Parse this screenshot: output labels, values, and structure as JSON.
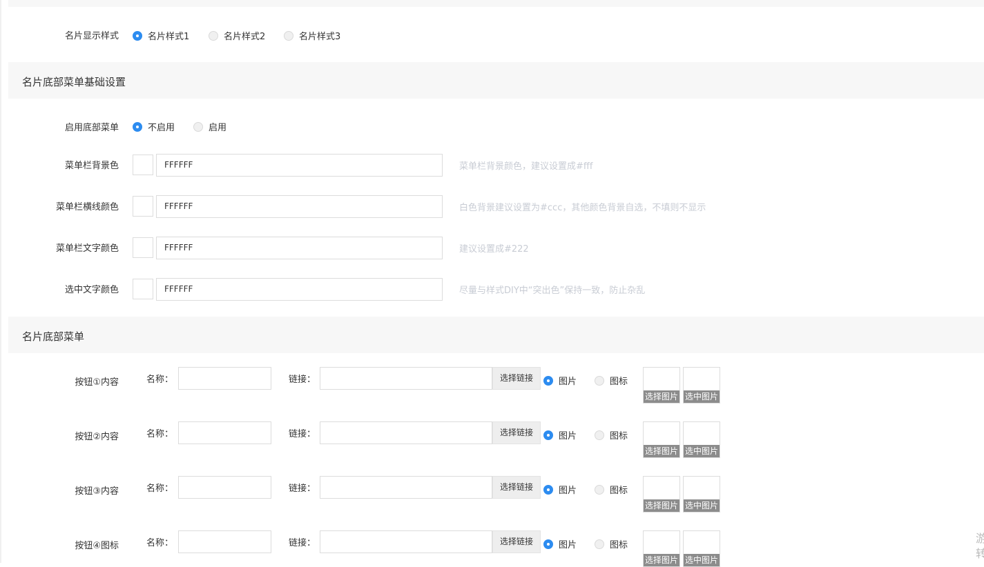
{
  "display_style": {
    "label": "名片显示样式",
    "options": [
      "名片样式1",
      "名片样式2",
      "名片样式3"
    ],
    "selected": 0
  },
  "menu_basic": {
    "title": "名片底部菜单基础设置",
    "enable_label": "启用底部菜单",
    "enable_options": [
      "不启用",
      "启用"
    ],
    "enable_selected": 0,
    "colors": [
      {
        "label": "菜单栏背景色",
        "value": "FFFFFF",
        "hint": "菜单栏背景颜色，建议设置成#fff"
      },
      {
        "label": "菜单栏横线颜色",
        "value": "FFFFFF",
        "hint": "白色背景建议设置为#ccc，其他颜色背景自选，不填则不显示"
      },
      {
        "label": "菜单栏文字颜色",
        "value": "FFFFFF",
        "hint": "建议设置成#222"
      },
      {
        "label": "选中文字颜色",
        "value": "FFFFFF",
        "hint": "尽量与样式DIY中“突出色”保持一致，防止杂乱"
      }
    ]
  },
  "menu_buttons": {
    "title": "名片底部菜单",
    "name_label": "名称：",
    "link_label": "链接：",
    "choose_link": "选择链接",
    "type_options": [
      "图片",
      "图标"
    ],
    "choose_image": "选择图片",
    "selected_image": "选中图片",
    "buttons": [
      {
        "label": "按钮①内容",
        "name": "",
        "link": "",
        "type_selected": 0
      },
      {
        "label": "按钮②内容",
        "name": "",
        "link": "",
        "type_selected": 0
      },
      {
        "label": "按钮③内容",
        "name": "",
        "link": "",
        "type_selected": 0
      },
      {
        "label": "按钮④图标",
        "name": "",
        "link": "",
        "type_selected": 0
      }
    ]
  },
  "edge_text": "游转"
}
